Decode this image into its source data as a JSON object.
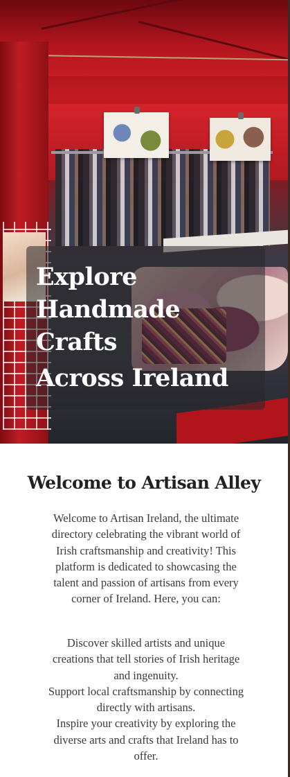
{
  "hero": {
    "title_lines": [
      "Explore",
      "Handmade",
      "Crafts",
      "Across Ireland"
    ]
  },
  "welcome": {
    "heading": "Welcome to Artisan Alley",
    "intro": "Welcome to Artisan Ireland, the ultimate directory celebrating the vibrant world of Irish craftsmanship and creativity! This platform is dedicated to showcasing the talent and passion of artisans from every corner of Ireland. Here, you can:",
    "items": [
      "Discover skilled artists and unique creations that tell stories of Irish heritage and ingenuity.",
      "Support local craftsmanship by connecting directly with artisans.",
      "Inspire your creativity by exploring the diverse arts and crafts that Ireland has to offer."
    ]
  },
  "colors": {
    "hero_overlay": "#28282c",
    "heading_text": "#222222",
    "body_text": "#3a3a3a",
    "page_edge": "#3a2a24"
  }
}
